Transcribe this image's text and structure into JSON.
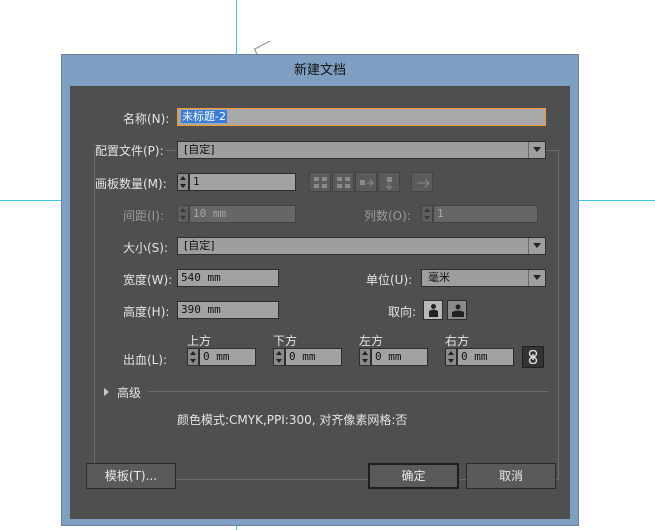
{
  "dialog": {
    "title": "新建文档",
    "name_label": "名称(N):",
    "name_value": "未标题-2",
    "profile_label": "配置文件(P):",
    "profile_value": "[自定]",
    "artboards_label": "画板数量(M):",
    "artboards_value": "1",
    "spacing_label": "间距(I):",
    "spacing_value": "10 mm",
    "columns_label": "列数(O):",
    "columns_value": "1",
    "size_label": "大小(S):",
    "size_value": "[自定]",
    "width_label": "宽度(W):",
    "width_value": "540 mm",
    "units_label": "单位(U):",
    "units_value": "毫米",
    "height_label": "高度(H):",
    "height_value": "390 mm",
    "orientation_label": "取向:",
    "bleed_label": "出血(L):",
    "bleed": {
      "top_label": "上方",
      "top_value": "0 mm",
      "bottom_label": "下方",
      "bottom_value": "0 mm",
      "left_label": "左方",
      "left_value": "0 mm",
      "right_label": "右方",
      "right_value": "0 mm"
    },
    "advanced_label": "高级",
    "info_text": "颜色模式:CMYK,PPI:300, 对齐像素网格:否",
    "templates_button": "模板(T)...",
    "ok_button": "确定",
    "cancel_button": "取消"
  },
  "colors": {
    "dialog_frame": "#7f9fc2",
    "dialog_body": "#4f4f4f",
    "focus_border": "#f29a38",
    "selection": "#3b7bd6",
    "guide": "#40c4e8"
  },
  "icons": [
    "grid-by-row-icon",
    "grid-by-column-icon",
    "arrange-by-row-icon",
    "arrange-by-column-icon",
    "right-to-left-icon",
    "portrait-icon",
    "landscape-icon",
    "link-icon",
    "disclosure-triangle-icon"
  ]
}
